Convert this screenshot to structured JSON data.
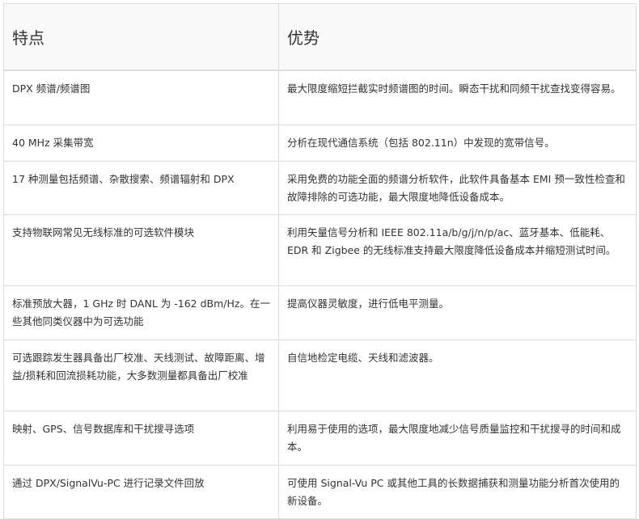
{
  "table": {
    "headers": [
      "特点",
      "优势"
    ],
    "rows": [
      {
        "feature": "DPX 频谱/频谱图",
        "advantage": "最大限度缩短拦截实时频谱图的时间。瞬态干扰和同频干扰查找变得容易。"
      },
      {
        "feature": "40 MHz 采集带宽",
        "advantage": "分析在现代通信系统（包括 802.11n）中发现的宽带信号。"
      },
      {
        "feature": "17 种测量包括频谱、杂散搜索、频谱辐射和 DPX",
        "advantage": "采用免费的功能全面的频谱分析软件，此软件具备基本 EMI 预一致性检查和故障排除的可选功能，最大限度地降低设备成本。"
      },
      {
        "feature": "支持物联网常见无线标准的可选软件模块",
        "advantage": "利用矢量信号分析和 IEEE 802.11a/b/g/j/n/p/ac、蓝牙基本、低能耗、EDR 和 Zigbee 的无线标准支持最大限度降低设备成本并缩短测试时间。"
      },
      {
        "feature": "标准预放大器，1 GHz 时 DANL 为 -162 dBm/Hz。在一些其他同类仪器中为可选功能",
        "advantage": "提高仪器灵敏度，进行低电平测量。"
      },
      {
        "feature": "可选跟踪发生器具备出厂校准、天线测试、故障距离、增益/损耗和回流损耗功能，大多数测量都具备出厂校准",
        "advantage": "自信地检定电缆、天线和滤波器。"
      },
      {
        "feature": "映射、GPS、信号数据库和干扰搜寻选项",
        "advantage": "利用易于使用的选项，最大限度地减少信号质量监控和干扰搜寻的时间和成本。"
      },
      {
        "feature": "通过 DPX/SignalVu-PC 进行记录文件回放",
        "advantage": "可使用 Signal-Vu PC 或其他工具的长数据捕获和测量功能分析首次使用的新设备。"
      }
    ]
  }
}
